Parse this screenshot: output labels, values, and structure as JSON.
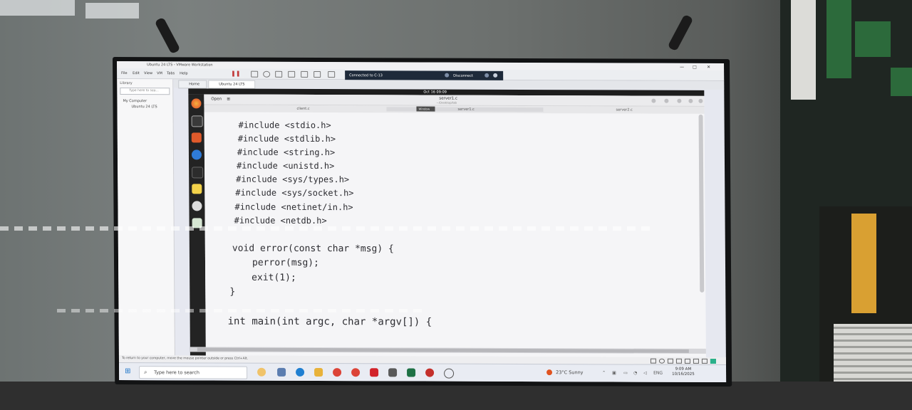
{
  "vmware": {
    "title": "Ubuntu 24 LTS - VMware Workstation",
    "menu": [
      "File",
      "Edit",
      "View",
      "VM",
      "Tabs",
      "Help"
    ],
    "connection": "Connected to C-13",
    "disconnect": "Disconnect",
    "library_title": "Library",
    "library_search_placeholder": "Type here to sea...",
    "tree_root": "My Computer",
    "tree_child": "Ubuntu 24 LTS",
    "tabs": [
      "Home",
      "Ubuntu 24 LTS"
    ],
    "status_text": "To return to your computer, move the mouse pointer outside or press Ctrl+Alt."
  },
  "ubuntu": {
    "clock": "Oct 16  09:09"
  },
  "gedit": {
    "open_label": "Open",
    "title": "server1.c",
    "subtitle": "~/Desktop/lab",
    "doc_tabs": [
      "client.c",
      "server1.c",
      "server2.c"
    ],
    "tooltip": "Window",
    "code_lines": [
      {
        "text": "#include <stdio.h>"
      },
      {
        "text": "#include <stdlib.h>"
      },
      {
        "text": "#include <string.h>"
      },
      {
        "text": "#include <unistd.h>"
      },
      {
        "text": "#include <sys/types.h>"
      },
      {
        "text": "#include <sys/socket.h>"
      },
      {
        "text": "#include <netinet/in.h>"
      },
      {
        "text": "#include <netdb.h>"
      },
      {
        "text": "void error(const char *msg) {"
      },
      {
        "text": "perror(msg);"
      },
      {
        "text": "exit(1);"
      },
      {
        "text": "}"
      },
      {
        "text": "int main(int argc, char *argv[]) {"
      }
    ]
  },
  "taskbar": {
    "search_placeholder": "Type here to search",
    "weather": "23°C  Sunny",
    "language": "ENG",
    "time": "9:09 AM",
    "date": "10/16/2025",
    "accent": "#1a73c8"
  }
}
